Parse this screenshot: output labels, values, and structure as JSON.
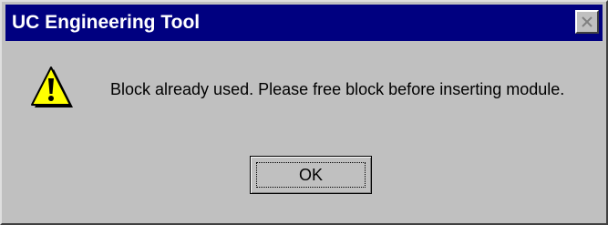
{
  "window": {
    "title": "UC Engineering Tool"
  },
  "titlebar": {
    "close_icon": "close-icon"
  },
  "dialog": {
    "icon": "warning-icon",
    "message": "Block already used. Please free block before inserting module.",
    "ok_label": "OK"
  },
  "colors": {
    "titlebar": "#000080",
    "face": "#c0c0c0",
    "warning_yellow": "#ffff00"
  }
}
